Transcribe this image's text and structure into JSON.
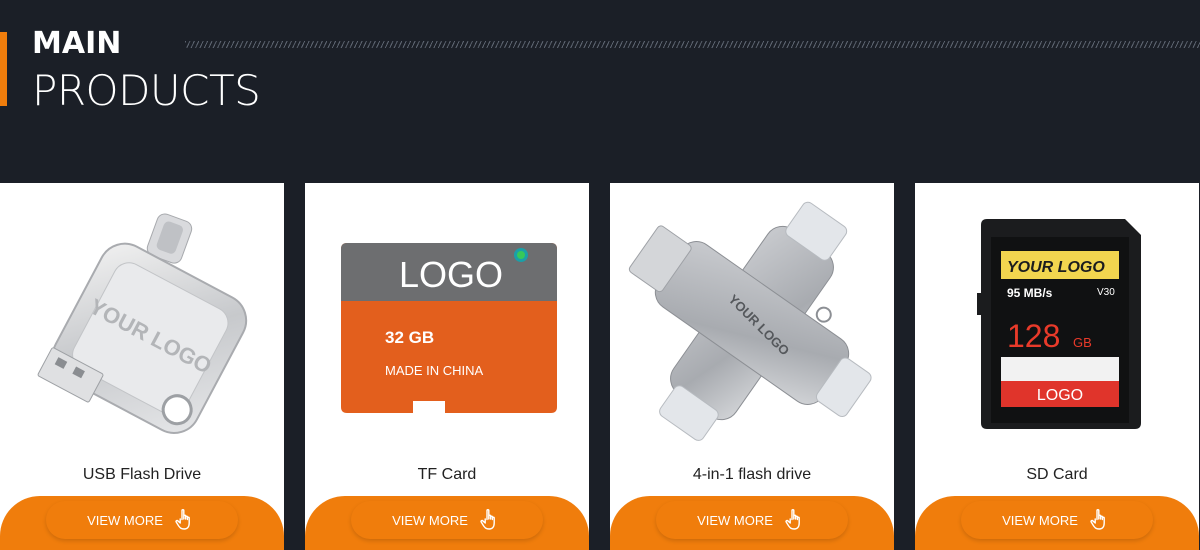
{
  "header": {
    "title_line1": "MAIN",
    "title_line2": "PRODUCTS"
  },
  "colors": {
    "accent": "#f07d0c",
    "background": "#1b1f27"
  },
  "products": [
    {
      "name": "USB Flash Drive",
      "button_label": "VIEW MORE",
      "image_text": "YOUR LOGO"
    },
    {
      "name": "TF Card",
      "button_label": "VIEW MORE",
      "image_text": "LOGO",
      "capacity": "32 GB",
      "origin": "MADE IN CHINA"
    },
    {
      "name": "4-in-1 flash drive",
      "button_label": "VIEW MORE",
      "image_text": "YOUR LOGO"
    },
    {
      "name": "SD Card",
      "button_label": "VIEW MORE",
      "image_text": "YOUR LOGO",
      "speed": "95 MB/s",
      "class_v": "V30",
      "capacity_num": "128",
      "capacity_unit": "GB",
      "bottom_logo": "LOGO"
    }
  ],
  "icons": {
    "button_icon": "hand-pointer-icon"
  }
}
